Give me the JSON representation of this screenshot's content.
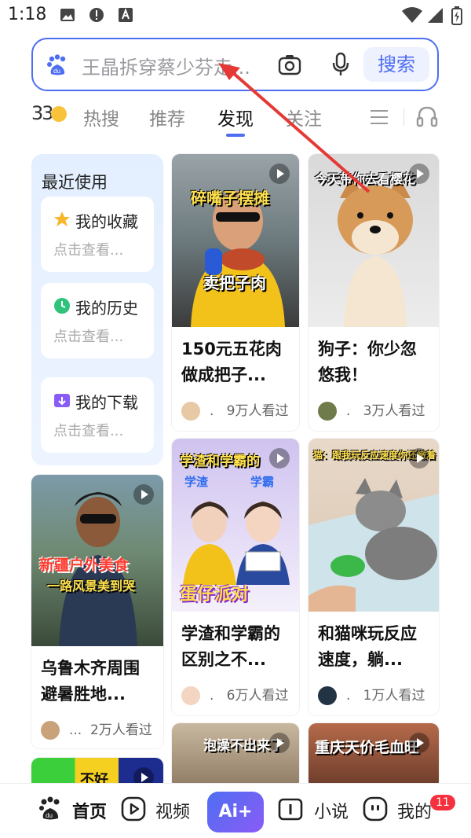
{
  "status_bar": {
    "time": "1:18"
  },
  "search": {
    "placeholder": "王晶拆穿蔡少芬走...",
    "button_label": "搜索"
  },
  "weather": {
    "temp": "33"
  },
  "tabs": [
    {
      "label": "热搜"
    },
    {
      "label": "推荐"
    },
    {
      "label": "发现"
    },
    {
      "label": "关注"
    }
  ],
  "recent": {
    "title": "最近使用",
    "items": [
      {
        "label": "我的收藏",
        "sub": "点击查看..."
      },
      {
        "label": "我的历史",
        "sub": "点击查看..."
      },
      {
        "label": "我的下载",
        "sub": "点击查看..."
      }
    ]
  },
  "feed": [
    {
      "title": "150元五花肉做成把子...",
      "author": ".",
      "views": "9万人看过",
      "overlay_top": "碎嘴子摆摊",
      "overlay_bottom": "卖把子肉"
    },
    {
      "title": "狗子：你少忽悠我！",
      "author": ".",
      "views": "3万人看过",
      "overlay_top": "今天带你去看樱花"
    },
    {
      "title": "乌鲁木齐周围避暑胜地...",
      "author": "...",
      "views": "2万人看过",
      "overlay_top": "新疆户外美食",
      "overlay_bottom": "一路风景美到哭"
    },
    {
      "title": "学渣和学霸的区别之不...",
      "author": ".",
      "views": "6万人看过",
      "overlay_top": "学渣和学霸的",
      "overlay_left": "学渣",
      "overlay_right": "学霸",
      "overlay_bottom": "蛋仔派对"
    },
    {
      "title": "和猫咪玩反应速度，躺...",
      "author": ".",
      "views": "1万人看过",
      "overlay_top": "猫：跟我玩反应速度你还嫩着"
    },
    {
      "overlay_top": "泡澡不出来了"
    },
    {
      "overlay_top": "重庆天价毛血旺"
    },
    {
      "overlay_top": "不好"
    }
  ],
  "nav": {
    "home": "首页",
    "video": "视频",
    "ai": "Ai+",
    "novel": "小说",
    "mine": "我的",
    "badge": "11"
  },
  "colors": {
    "accent": "#4e6ef2",
    "badge": "#f5313d"
  }
}
